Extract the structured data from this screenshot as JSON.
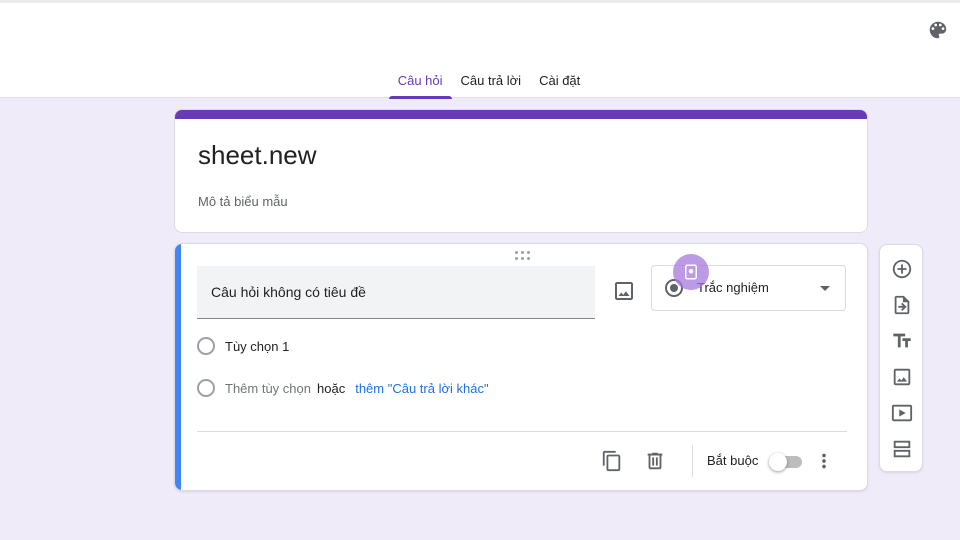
{
  "tabs": [
    {
      "label": "Câu hỏi",
      "active": true
    },
    {
      "label": "Câu trả lời",
      "active": false
    },
    {
      "label": "Cài đặt",
      "active": false
    }
  ],
  "form": {
    "title": "sheet.new",
    "description_placeholder": "Mô tả biểu mẫu"
  },
  "question": {
    "title_placeholder": "Câu hỏi không có tiêu đề",
    "type_label": "Trắc nghiệm",
    "options": [
      {
        "label": "Tùy chọn 1"
      }
    ],
    "add_option": "Thêm tùy chọn",
    "or_text": "hoặc",
    "add_other": "thêm \"Câu trả lời khác\"",
    "required_label": "Bắt buộc",
    "required": false
  },
  "icons": {
    "palette": "palette-icon",
    "image": "image-icon",
    "copy": "copy-icon",
    "trash": "trash-icon",
    "more": "more-vert-icon",
    "add": "add-circle-icon",
    "import": "import-icon",
    "title": "title-icon",
    "add_image": "image-icon",
    "video": "video-icon",
    "section": "section-icon"
  },
  "colors": {
    "accent": "#673ab7",
    "background": "#f0ebf8",
    "active_card": "#4285f4",
    "link": "#1a73e8"
  }
}
